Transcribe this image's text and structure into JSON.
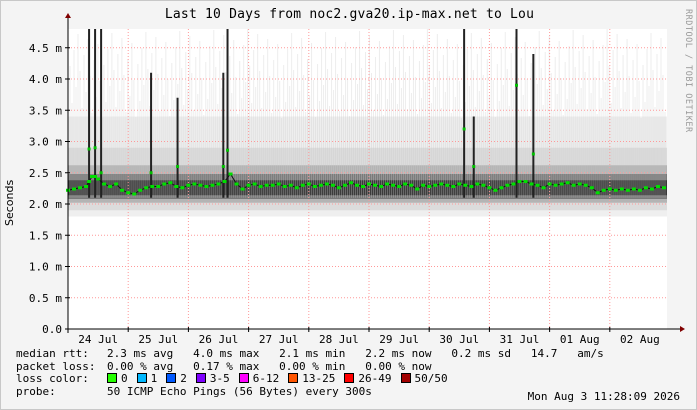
{
  "chart_data": {
    "type": "line",
    "title": "Last 10 Days from noc2.gva20.ip-max.net to Lou",
    "ylabel": "Seconds",
    "side_label": "RRDTOOL / TOBI OETIKER",
    "y_ticks": [
      "0.0",
      "0.5 m",
      "1.0 m",
      "1.5 m",
      "2.0 m",
      "2.5 m",
      "3.0 m",
      "3.5 m",
      "4.0 m",
      "4.5 m"
    ],
    "y_tick_values": [
      0,
      0.0005,
      0.001,
      0.0015,
      0.002,
      0.0025,
      0.003,
      0.0035,
      0.004,
      0.0045
    ],
    "ylim": [
      0,
      0.0048
    ],
    "x_ticks": [
      "24 Jul",
      "25 Jul",
      "26 Jul",
      "27 Jul",
      "28 Jul",
      "29 Jul",
      "30 Jul",
      "31 Jul",
      "01 Aug",
      "02 Aug"
    ],
    "x_days_range": [
      0,
      9.95
    ],
    "grid": true,
    "series": [
      {
        "name": "median rtt",
        "color": "#00e000",
        "x": [
          0.0,
          0.1,
          0.2,
          0.3,
          0.35,
          0.4,
          0.45,
          0.5,
          0.6,
          0.7,
          0.8,
          0.9,
          1.0,
          1.1,
          1.2,
          1.3,
          1.4,
          1.5,
          1.6,
          1.7,
          1.8,
          1.9,
          2.0,
          2.1,
          2.2,
          2.3,
          2.4,
          2.5,
          2.6,
          2.7,
          2.8,
          2.9,
          3.0,
          3.1,
          3.2,
          3.3,
          3.4,
          3.5,
          3.6,
          3.7,
          3.8,
          3.9,
          4.0,
          4.1,
          4.2,
          4.3,
          4.4,
          4.5,
          4.6,
          4.7,
          4.8,
          4.9,
          5.0,
          5.1,
          5.2,
          5.3,
          5.4,
          5.5,
          5.6,
          5.7,
          5.8,
          5.9,
          6.0,
          6.1,
          6.2,
          6.3,
          6.4,
          6.5,
          6.6,
          6.7,
          6.8,
          6.9,
          7.0,
          7.1,
          7.2,
          7.3,
          7.4,
          7.5,
          7.6,
          7.7,
          7.8,
          7.9,
          8.0,
          8.1,
          8.2,
          8.3,
          8.4,
          8.5,
          8.6,
          8.7,
          8.8,
          8.9,
          9.0,
          9.1,
          9.2,
          9.3,
          9.4,
          9.5,
          9.6,
          9.7,
          9.8,
          9.9
        ],
        "values": [
          0.00222,
          0.00224,
          0.00226,
          0.00228,
          0.00236,
          0.00244,
          0.00244,
          0.0024,
          0.00232,
          0.00228,
          0.00232,
          0.00222,
          0.00218,
          0.00216,
          0.00222,
          0.00226,
          0.00228,
          0.00228,
          0.00232,
          0.00234,
          0.00228,
          0.00226,
          0.0023,
          0.00232,
          0.0023,
          0.00228,
          0.0023,
          0.00232,
          0.00236,
          0.00248,
          0.00232,
          0.00224,
          0.0023,
          0.00232,
          0.00228,
          0.0023,
          0.0023,
          0.00232,
          0.00228,
          0.0023,
          0.00226,
          0.0023,
          0.00232,
          0.00228,
          0.0023,
          0.00232,
          0.0023,
          0.00226,
          0.0023,
          0.00234,
          0.0023,
          0.00228,
          0.00232,
          0.0023,
          0.00228,
          0.00232,
          0.0023,
          0.00228,
          0.00232,
          0.0023,
          0.00224,
          0.0023,
          0.00228,
          0.0023,
          0.00232,
          0.0023,
          0.00228,
          0.00232,
          0.0023,
          0.00228,
          0.00232,
          0.0023,
          0.00226,
          0.00222,
          0.00226,
          0.0023,
          0.00232,
          0.00236,
          0.00236,
          0.00232,
          0.0023,
          0.00226,
          0.00232,
          0.0023,
          0.00232,
          0.00234,
          0.0023,
          0.00232,
          0.0023,
          0.00226,
          0.00218,
          0.00222,
          0.00224,
          0.00222,
          0.00224,
          0.00222,
          0.00224,
          0.00222,
          0.00226,
          0.00224,
          0.00228,
          0.00226
        ]
      }
    ],
    "spikes": [
      {
        "x": 0.35,
        "value": 0.00288,
        "top": 0.0048
      },
      {
        "x": 0.45,
        "value": 0.0029,
        "top": 0.0048
      },
      {
        "x": 0.55,
        "value": 0.0025,
        "top": 0.0048
      },
      {
        "x": 1.38,
        "value": 0.0025,
        "top": 0.0041
      },
      {
        "x": 1.82,
        "value": 0.0026,
        "top": 0.0037
      },
      {
        "x": 2.58,
        "value": 0.0026,
        "top": 0.0041
      },
      {
        "x": 2.65,
        "value": 0.00286,
        "top": 0.0048
      },
      {
        "x": 6.58,
        "value": 0.0032,
        "top": 0.0048
      },
      {
        "x": 6.74,
        "value": 0.0026,
        "top": 0.0034
      },
      {
        "x": 7.45,
        "value": 0.0039,
        "top": 0.0048
      },
      {
        "x": 7.73,
        "value": 0.0028,
        "top": 0.0044
      }
    ]
  },
  "legend": {
    "median_rtt_label": "median rtt:",
    "median_rtt_values": "2.3 ms avg   4.0 ms max   2.1 ms min   2.2 ms now   0.2 ms sd   14.7   am/s",
    "packet_loss_label": "packet loss:",
    "packet_loss_values": "0.00 % avg   0.17 % max   0.00 % min   0.00 % now",
    "loss_color_label": "loss color:",
    "loss_colors": [
      {
        "label": "0",
        "color": "#26ff00"
      },
      {
        "label": "1",
        "color": "#00b8ff"
      },
      {
        "label": "2",
        "color": "#0059ff"
      },
      {
        "label": "3-5",
        "color": "#7e00ff"
      },
      {
        "label": "6-12",
        "color": "#ff00ff"
      },
      {
        "label": "13-25",
        "color": "#ff5500"
      },
      {
        "label": "26-49",
        "color": "#ff0000"
      },
      {
        "label": "50/50",
        "color": "#a10000"
      }
    ],
    "probe_label": "probe:",
    "probe_values": "50 ICMP Echo Pings (56 Bytes) every 300s",
    "timestamp": "Mon Aug  3 11:28:09 2026"
  }
}
